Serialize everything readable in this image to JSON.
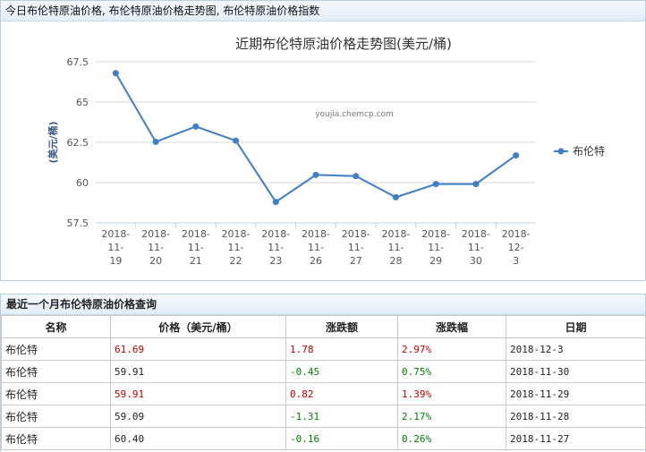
{
  "page_title": "今日布伦特原油价格, 布伦特原油价格走势图, 布伦特原油价格指数",
  "chart_data": {
    "type": "line",
    "title": "近期布伦特原油价格走势图(美元/桶)",
    "watermark": "youjia.chemcp.com",
    "ylabel": "(美元/桶)",
    "ylim": [
      57.5,
      67.5
    ],
    "yticks": [
      "57.5",
      "60",
      "62.5",
      "65",
      "67.5"
    ],
    "categories": [
      "2018-11-19",
      "2018-11-20",
      "2018-11-21",
      "2018-11-22",
      "2018-11-23",
      "2018-11-26",
      "2018-11-27",
      "2018-11-28",
      "2018-11-29",
      "2018-11-30",
      "2018-12-3"
    ],
    "series": [
      {
        "name": "布伦特",
        "color": "#3e7fc9",
        "values": [
          66.79,
          62.53,
          63.48,
          62.6,
          58.8,
          60.48,
          60.4,
          59.09,
          59.91,
          59.91,
          61.69
        ]
      }
    ],
    "legend_position": "right",
    "grid": true
  },
  "table": {
    "title": "最近一个月布伦特原油价格查询",
    "headers": [
      "名称",
      "价格（美元/桶）",
      "涨跌额",
      "涨跌幅",
      "日期"
    ],
    "rows": [
      {
        "name": "布伦特",
        "price": "61.69",
        "change": "1.78",
        "pct": "2.97%",
        "date": "2018-12-3",
        "price_dir": "up",
        "change_dir": "up",
        "pct_dir": "up"
      },
      {
        "name": "布伦特",
        "price": "59.91",
        "change": "-0.45",
        "pct": "0.75%",
        "date": "2018-11-30",
        "price_dir": "plain",
        "change_dir": "down",
        "pct_dir": "down"
      },
      {
        "name": "布伦特",
        "price": "59.91",
        "change": "0.82",
        "pct": "1.39%",
        "date": "2018-11-29",
        "price_dir": "up",
        "change_dir": "up",
        "pct_dir": "up"
      },
      {
        "name": "布伦特",
        "price": "59.09",
        "change": "-1.31",
        "pct": "2.17%",
        "date": "2018-11-28",
        "price_dir": "plain",
        "change_dir": "down",
        "pct_dir": "down"
      },
      {
        "name": "布伦特",
        "price": "60.40",
        "change": "-0.16",
        "pct": "0.26%",
        "date": "2018-11-27",
        "price_dir": "plain",
        "change_dir": "down",
        "pct_dir": "down"
      }
    ]
  }
}
